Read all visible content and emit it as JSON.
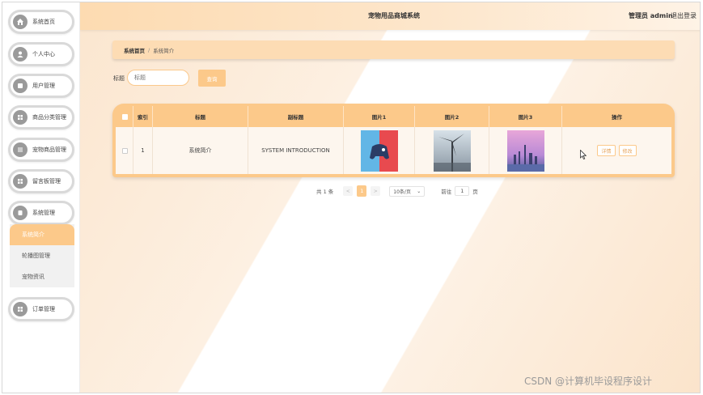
{
  "header": {
    "title": "宠物用品商城系统",
    "user": "管理员 admin",
    "logout": "退出登录"
  },
  "sidebar": {
    "items": [
      {
        "label": "系统首页",
        "icon": "home-icon"
      },
      {
        "label": "个人中心",
        "icon": "user-icon"
      },
      {
        "label": "用户管理",
        "icon": "users-icon"
      },
      {
        "label": "商品分类管理",
        "icon": "grid-icon"
      },
      {
        "label": "宠物商品管理",
        "icon": "list-icon"
      },
      {
        "label": "留言板管理",
        "icon": "grid-icon"
      },
      {
        "label": "系统管理",
        "icon": "settings-icon"
      },
      {
        "label": "订单管理",
        "icon": "grid-icon"
      }
    ],
    "submenu": [
      {
        "label": "系统简介",
        "active": true
      },
      {
        "label": "轮播图管理",
        "active": false
      },
      {
        "label": "宠物资讯",
        "active": false
      }
    ]
  },
  "breadcrumb": {
    "home": "系统首页",
    "separator": "/",
    "current": "系统简介"
  },
  "search": {
    "label": "标题",
    "placeholder": "标题",
    "button": "查询"
  },
  "table": {
    "columns": [
      "索引",
      "标题",
      "副标题",
      "图片1",
      "图片2",
      "图片3",
      "操作"
    ],
    "rows": [
      {
        "index": "1",
        "title": "系统简介",
        "subtitle": "SYSTEM INTRODUCTION",
        "actions": [
          "详情",
          "修改"
        ]
      }
    ]
  },
  "pagination": {
    "total": "共 1 条",
    "prev": "<",
    "current_page": "1",
    "next": ">",
    "page_size": "10条/页",
    "goto_label": "前往",
    "goto_value": "1",
    "page_unit": "页"
  },
  "watermark": "CSDN @计算机毕设程序设计",
  "colors": {
    "accent": "#fcc98a",
    "header": "#fddbb1"
  }
}
